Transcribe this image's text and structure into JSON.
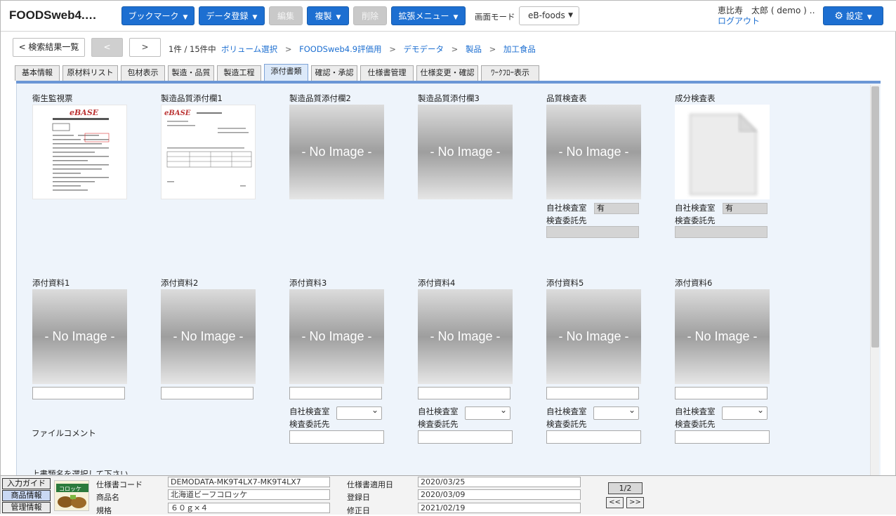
{
  "header": {
    "app_title": "FOODSweb4.…",
    "bookmark": "ブックマーク",
    "data_register": "データ登録",
    "edit": "編集",
    "duplicate": "複製",
    "delete": "削除",
    "extend_menu": "拡張メニュー",
    "mode_label": "画面モード",
    "mode_value": "eB-foods",
    "user_name": "恵比寿　太郎 ( demo ) …",
    "logout": "ログアウト",
    "settings": "設定"
  },
  "nav": {
    "back": "< 検索結果一覧",
    "prev": "<",
    "next": ">",
    "count": "1件 / 15件中",
    "breadcrumb": [
      "ボリューム選択",
      "FOODSweb4.9評価用",
      "デモデータ",
      "製品",
      "加工食品"
    ],
    "sep1": ">",
    "sep2": ">",
    "sep3": ">",
    "sep4": ">"
  },
  "tabs": [
    "基本情報",
    "原材料リスト",
    "包材表示",
    "製造・品質",
    "製造工程",
    "添付書類",
    "確認・承認",
    "仕様書管理",
    "仕様変更・確認",
    "ﾜｰｸﾌﾛｰ表示"
  ],
  "attachments": {
    "row1": [
      {
        "label": "衛生監視票",
        "image": "document"
      },
      {
        "label": "製造品質添付欄1",
        "image": "document"
      },
      {
        "label": "製造品質添付欄2",
        "image": "none"
      },
      {
        "label": "製造品質添付欄3",
        "image": "none"
      },
      {
        "label": "品質検査表",
        "image": "none"
      },
      {
        "label": "成分検査表",
        "image": "file"
      }
    ],
    "no_image": "- No Image -",
    "inhouse_label": "自社検査室",
    "consign_label": "検査委託先",
    "quality_inhouse_value": "有",
    "component_inhouse_value": "有",
    "row2": [
      {
        "label": "添付資料1"
      },
      {
        "label": "添付資料2"
      },
      {
        "label": "添付資料3"
      },
      {
        "label": "添付資料4"
      },
      {
        "label": "添付資料5"
      },
      {
        "label": "添付資料6"
      }
    ],
    "file_comment": "ファイルコメント",
    "bottom_hint": "上書類名を選択して下さい"
  },
  "doc_logo": "eBASE",
  "footer": {
    "input_guide": "入力ガイド",
    "product_info": "商品情報",
    "admin_info": "管理情報",
    "spec_code_label": "仕様書コード",
    "spec_code": "DEMODATA-MK9T4LX7-MK9T4LX7",
    "product_name_label": "商品名",
    "product_name": "北海道ビーフコロッケ",
    "standard_label": "規格",
    "standard": "６０ｇ×４",
    "apply_date_label": "仕様書適用日",
    "apply_date": "2020/03/25",
    "register_date_label": "登録日",
    "register_date": "2020/03/09",
    "modify_date_label": "修正日",
    "modify_date": "2021/02/19",
    "page": "1/2",
    "first": "<<",
    "last": ">>"
  }
}
